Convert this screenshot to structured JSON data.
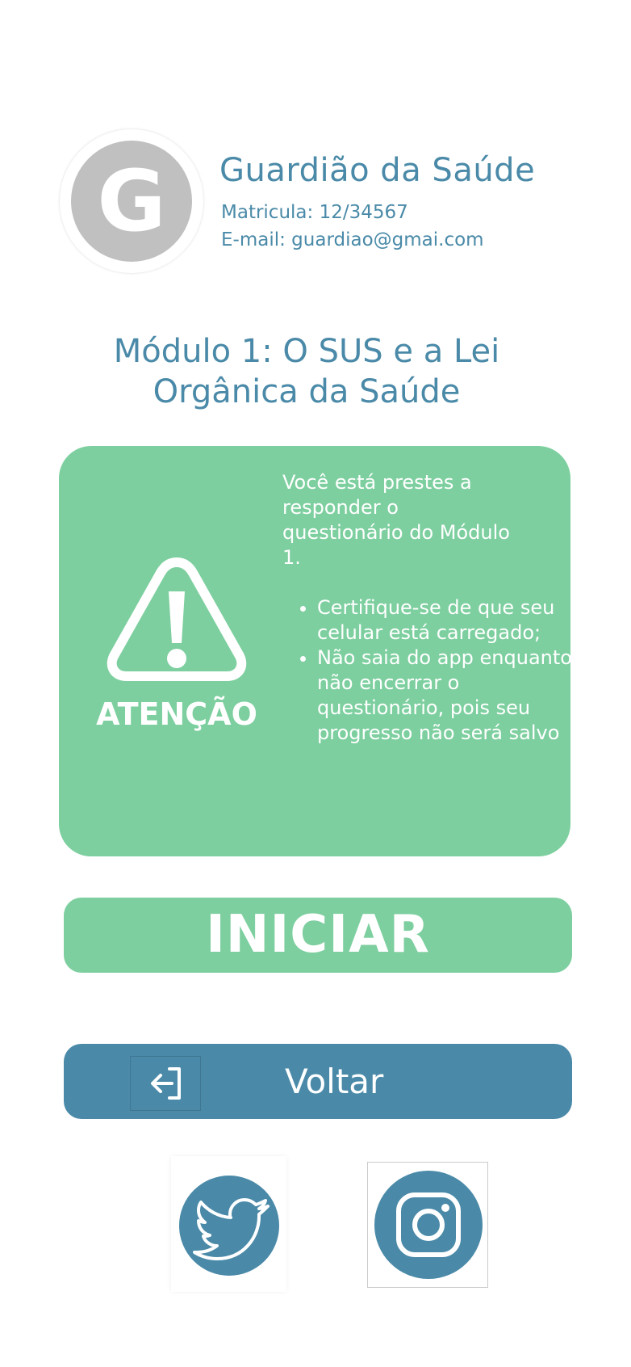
{
  "profile": {
    "avatar_initial": "G",
    "name": "Guardião da Saúde",
    "registration": "Matricula: 12/34567",
    "email": "E-mail: guardiao@gmai.com"
  },
  "module": {
    "title_line1": "Módulo 1: O SUS e a Lei",
    "title_line2": "Orgânica da Saúde"
  },
  "warning": {
    "icon": "warning-triangle-icon",
    "label": "ATENÇÃO",
    "intro": "Você está prestes a responder o questionário do Módulo 1.",
    "items": [
      "Certifique-se de que seu celular está carregado;",
      "Não saia do app enquanto não encerrar o questionário, pois seu progresso não será salvo"
    ]
  },
  "actions": {
    "start_label": "INICIAR",
    "back_label": "Voltar",
    "back_icon": "exit-arrow-icon"
  },
  "social": {
    "twitter_icon": "twitter-icon",
    "instagram_icon": "instagram-icon"
  },
  "colors": {
    "primary_blue": "#4a8aa8",
    "accent_green": "#7dcf9f",
    "avatar_gray": "#c0c0c0"
  }
}
